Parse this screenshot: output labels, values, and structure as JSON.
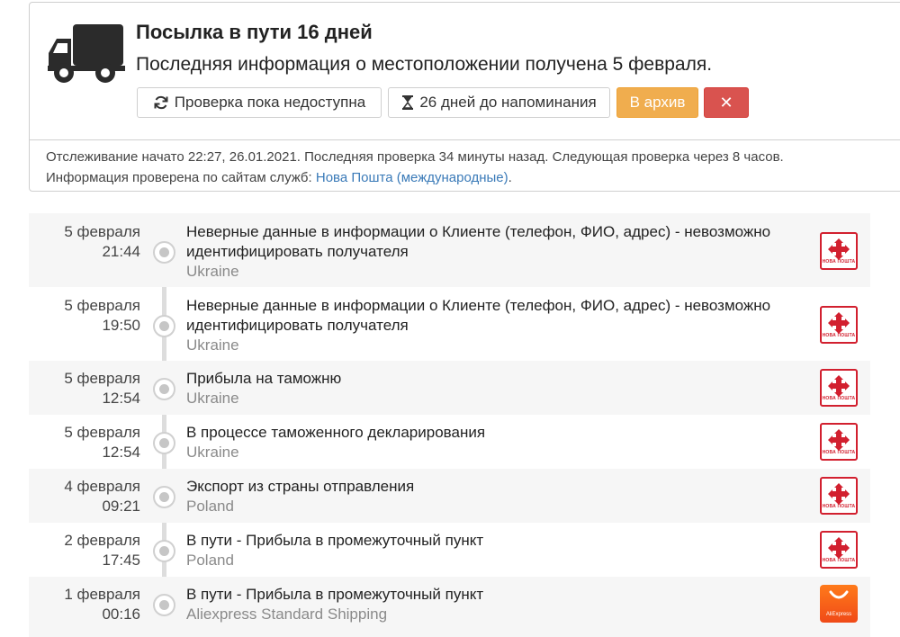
{
  "header": {
    "title": "Посылка в пути 16 дней",
    "subtitle": "Последняя информация о местоположении получена 5 февраля.",
    "icon": "truck-icon"
  },
  "actions": {
    "refresh_label": "Проверка пока недоступна",
    "refresh_icon": "refresh-icon",
    "reminder_label": "26 дней до напоминания",
    "reminder_icon": "hourglass-icon",
    "archive_label": "В архив",
    "delete_label": "✕"
  },
  "info": {
    "tracking_line": "Отслеживание начато 22:27, 26.01.2021. Последняя проверка 34 минуты назад. Следующая проверка через 8 часов.",
    "sources_prefix": "Информация проверена по сайтам служб: ",
    "sources_link": "Нова Пошта (международные)",
    "sources_suffix": "."
  },
  "colors": {
    "archive": "#f0ad4e",
    "delete": "#d9534f",
    "link": "#3a7ab8",
    "nova_poshta_red": "#d2202f",
    "aliexpress_orange": "#f5591f"
  },
  "events": [
    {
      "date": "5 февраля",
      "time": "21:44",
      "text": "Неверные данные в информации о Клиенте (телефон, ФИО, адрес) - невозможно идентифицировать получателя",
      "location": "Ukraine",
      "carrier": "НОВА ПОШТА"
    },
    {
      "date": "5 февраля",
      "time": "19:50",
      "text": "Неверные данные в информации о Клиенте (телефон, ФИО, адрес) - невозможно идентифицировать получателя",
      "location": "Ukraine",
      "carrier": "НОВА ПОШТА"
    },
    {
      "date": "5 февраля",
      "time": "12:54",
      "text": "Прибыла на таможню",
      "location": "Ukraine",
      "carrier": "НОВА ПОШТА"
    },
    {
      "date": "5 февраля",
      "time": "12:54",
      "text": "В процессе таможенного декларирования",
      "location": "Ukraine",
      "carrier": "НОВА ПОШТА"
    },
    {
      "date": "4 февраля",
      "time": "09:21",
      "text": "Экспорт из страны отправления",
      "location": "Poland",
      "carrier": "НОВА ПОШТА"
    },
    {
      "date": "2 февраля",
      "time": "17:45",
      "text": "В пути - Прибыла в промежуточный пункт",
      "location": "Poland",
      "carrier": "НОВА ПОШТА"
    },
    {
      "date": "1 февраля",
      "time": "00:16",
      "text": "В пути - Прибыла в промежуточный пункт",
      "location": "Aliexpress Standard Shipping",
      "carrier": "AliExpress"
    }
  ]
}
